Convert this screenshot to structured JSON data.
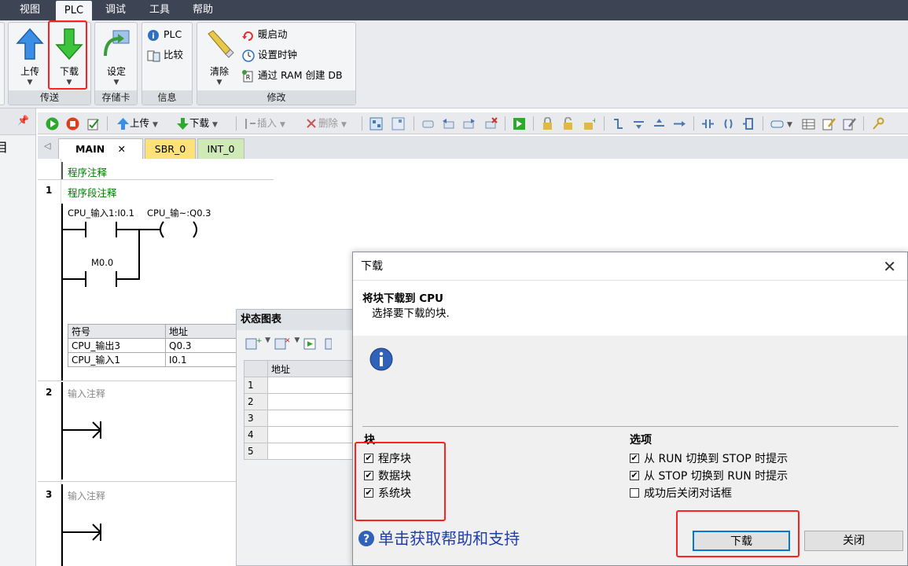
{
  "menubar": {
    "items": [
      "视图",
      "PLC",
      "调试",
      "工具",
      "帮助"
    ],
    "active": "PLC"
  },
  "ribbon": {
    "transfer": {
      "upload": "上传",
      "download": "下载",
      "label": "传送"
    },
    "memcard": {
      "set": "设定",
      "label": "存储卡"
    },
    "info": {
      "plc": "PLC",
      "compare": "比较",
      "label": "信息"
    },
    "modify": {
      "clear": "清除",
      "warm_start": "暖启动",
      "set_clock": "设置时钟",
      "ram_to_db": "通过 RAM 创建 DB",
      "label": "修改"
    }
  },
  "leftpanel": {
    "pin": "ꟷ",
    "glyph": "目"
  },
  "toolbar": {
    "upload": "上传",
    "download": "下载",
    "insert": "插入",
    "delete": "删除"
  },
  "tabs": [
    {
      "label": "MAIN"
    },
    {
      "label": "SBR_0"
    },
    {
      "label": "INT_0"
    }
  ],
  "editor": {
    "program_comment": "程序注释",
    "networks": [
      {
        "num": "1",
        "comment": "程序段注释",
        "contact1": "CPU_输入1:I0.1",
        "coil": "CPU_输~:Q0.3",
        "contact2": "M0.0"
      },
      {
        "num": "2",
        "comment": "输入注释"
      },
      {
        "num": "3",
        "comment": "输入注释"
      }
    ],
    "symbol_table": {
      "headers": [
        "符号",
        "地址"
      ],
      "rows": [
        [
          "CPU_输出3",
          "Q0.3"
        ],
        [
          "CPU_输入1",
          "I0.1"
        ]
      ]
    }
  },
  "status_chart": {
    "title": "状态图表",
    "col_address": "地址",
    "rows": [
      "1",
      "2",
      "3",
      "4",
      "5"
    ]
  },
  "dialog": {
    "title": "下载",
    "close_glyph": "✕",
    "heading": "将块下载到 CPU",
    "subheading": "选择要下载的块.",
    "blocks_label": "块",
    "blocks": [
      {
        "label": "程序块",
        "checked": true
      },
      {
        "label": "数据块",
        "checked": true
      },
      {
        "label": "系统块",
        "checked": true
      }
    ],
    "options_label": "选项",
    "options": [
      {
        "label": "从 RUN 切换到 STOP 时提示",
        "checked": true
      },
      {
        "label": "从 STOP 切换到 RUN 时提示",
        "checked": true
      },
      {
        "label": "成功后关闭对话框",
        "checked": false
      }
    ],
    "help_link": "单击获取帮助和支持",
    "download_button": "下载",
    "close_button": "关闭",
    "check_glyph": "✔"
  },
  "colors": {
    "highlight": "#ff2020",
    "menubar": "#3d4554",
    "main_tab": "#ffffff",
    "sbr_tab": "#fde27c",
    "int_tab": "#cfe9b7"
  }
}
